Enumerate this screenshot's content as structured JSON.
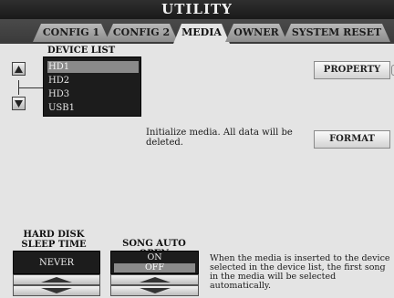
{
  "window": {
    "title": "UTILITY"
  },
  "tabs": [
    {
      "label": "CONFIG 1",
      "active": false
    },
    {
      "label": "CONFIG 2",
      "active": false
    },
    {
      "label": "MEDIA",
      "active": true
    },
    {
      "label": "OWNER",
      "active": false
    },
    {
      "label": "SYSTEM RESET",
      "active": false
    }
  ],
  "device_list": {
    "label": "DEVICE LIST",
    "items": [
      "HD1",
      "HD2",
      "HD3",
      "USB1"
    ],
    "selected": "HD1"
  },
  "buttons": {
    "property": "PROPERTY",
    "format": "FORMAT"
  },
  "format_message": "Initialize media. All data will be deleted.",
  "hard_disk_sleep": {
    "label": "HARD DISK SLEEP TIME",
    "value": "NEVER"
  },
  "song_auto_open": {
    "label": "SONG AUTO OPEN",
    "options": [
      "ON",
      "OFF"
    ],
    "selected": "OFF",
    "description": "When the media is inserted to the device selected in the device list, the first song in the media will be selected automatically."
  },
  "icons": {
    "up": "triangle-up-icon",
    "down": "triangle-down-icon"
  },
  "colors": {
    "title_bar": "#1f1f1f",
    "background": "#e4e4e4",
    "list_background": "#1c1c1c",
    "selection": "#8a8a8a"
  }
}
